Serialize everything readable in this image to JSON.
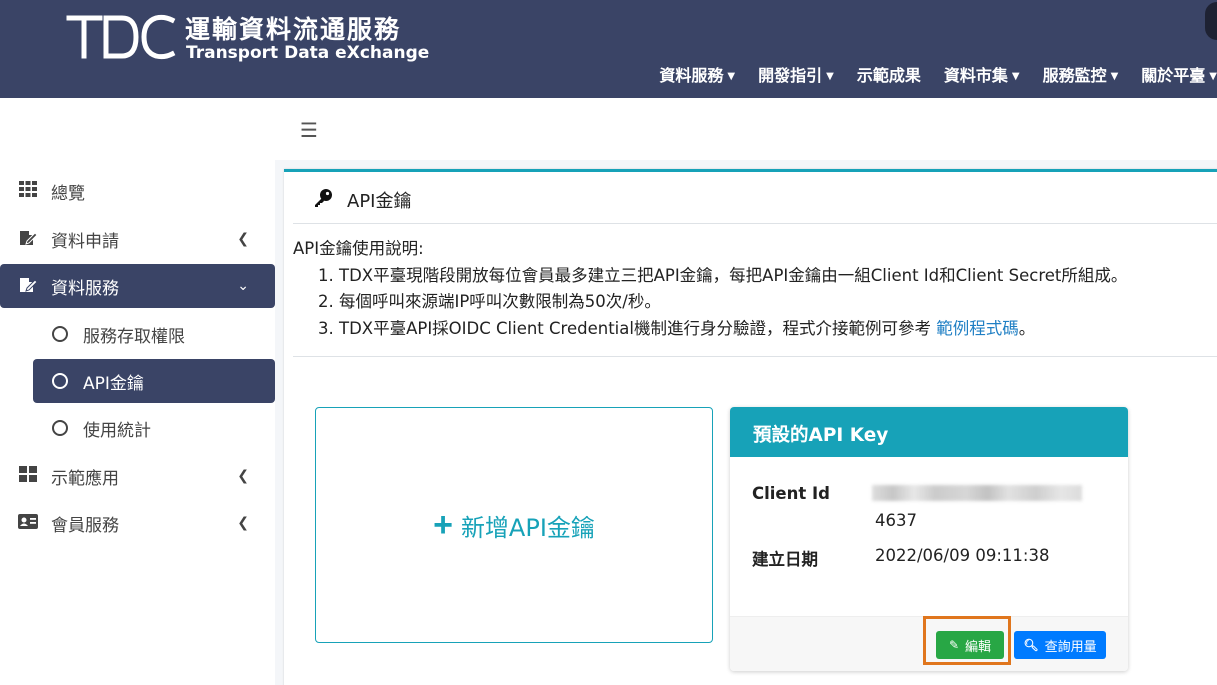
{
  "brand": {
    "logo_text": "TDC",
    "name_cn": "運輸資料流通服務",
    "name_en": "Transport Data eXchange"
  },
  "topnav": [
    {
      "label": "資料服務",
      "caret": true
    },
    {
      "label": "開發指引",
      "caret": true
    },
    {
      "label": "示範成果",
      "caret": false
    },
    {
      "label": "資料市集",
      "caret": true
    },
    {
      "label": "服務監控",
      "caret": true
    },
    {
      "label": "關於平臺",
      "caret": true
    }
  ],
  "sidebar": {
    "items": [
      {
        "label": "總覽",
        "icon": "grid-icon"
      },
      {
        "label": "資料申請",
        "icon": "edit-doc-icon"
      },
      {
        "label": "資料服務",
        "icon": "edit-doc-icon"
      },
      {
        "label": "示範應用",
        "icon": "tiles-icon"
      },
      {
        "label": "會員服務",
        "icon": "id-card-icon"
      }
    ],
    "subitems": [
      {
        "label": "服務存取權限"
      },
      {
        "label": "API金鑰"
      },
      {
        "label": "使用統計"
      }
    ]
  },
  "page": {
    "title": "API金鑰",
    "desc_heading": "API金鑰使用說明:",
    "desc_items": [
      "1. TDX平臺現階段開放每位會員最多建立三把API金鑰，每把API金鑰由一組Client Id和Client Secret所組成。",
      "2. 每個呼叫來源端IP呼叫次數限制為50次/秒。",
      "3. TDX平臺API採OIDC Client Credential機制進行身分驗證，程式介接範例可參考 "
    ],
    "desc_link": "範例程式碼",
    "desc_tail": "。",
    "add_key_label": "新增API金鑰"
  },
  "key_card": {
    "title": "預設的API Key",
    "client_id_label": "Client Id",
    "client_id_suffix": "4637",
    "created_label": "建立日期",
    "created_value": "2022/06/09 09:11:38",
    "edit_label": "編輯",
    "query_label": "查詢用量"
  },
  "colors": {
    "header_bg": "#3a4466",
    "accent_teal": "#17a2b8",
    "edit_green": "#28a745",
    "query_blue": "#007bff",
    "highlight_orange": "#e0761d"
  }
}
